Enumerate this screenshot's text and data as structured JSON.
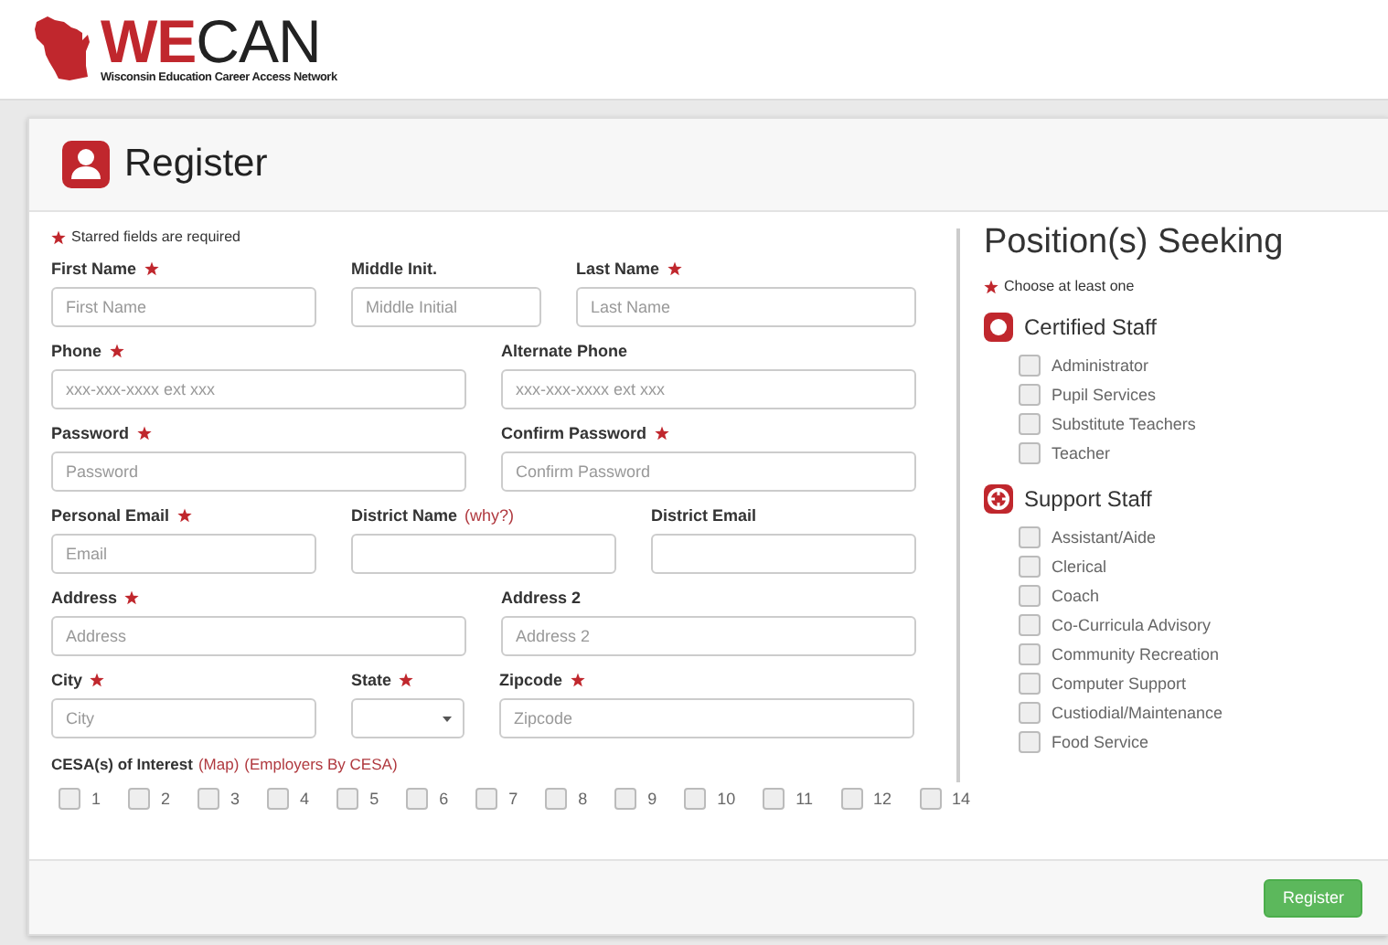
{
  "logo": {
    "wordmark_accent": "WE",
    "wordmark_rest": "CAN",
    "tagline": "Wisconsin Education Career Access Network"
  },
  "panel": {
    "title": "Register"
  },
  "form": {
    "required_note": "Starred fields are required",
    "rows": [
      {
        "fields": [
          {
            "label": "First Name",
            "required": true,
            "kind": "text",
            "placeholder": "First Name"
          },
          {
            "label": "Middle Init.",
            "required": false,
            "kind": "text",
            "placeholder": "Middle Initial"
          },
          {
            "label": "Last Name",
            "required": true,
            "kind": "text",
            "placeholder": "Last Name"
          }
        ]
      },
      {
        "fields": [
          {
            "label": "Phone",
            "required": true,
            "kind": "text",
            "placeholder": "xxx-xxx-xxxx ext xxx"
          },
          {
            "label": "Alternate Phone",
            "required": false,
            "kind": "text",
            "placeholder": "xxx-xxx-xxxx ext xxx"
          }
        ]
      },
      {
        "fields": [
          {
            "label": "Password",
            "required": true,
            "kind": "text",
            "placeholder": "Password"
          },
          {
            "label": "Confirm Password",
            "required": true,
            "kind": "text",
            "placeholder": "Confirm Password"
          }
        ]
      },
      {
        "fields": [
          {
            "label": "Personal Email",
            "required": true,
            "kind": "text",
            "placeholder": "Email"
          },
          {
            "label": "District Name",
            "link": "(why?)",
            "required": false,
            "kind": "text"
          },
          {
            "label": "District Email",
            "required": false,
            "kind": "text"
          }
        ]
      },
      {
        "fields": [
          {
            "label": "Address",
            "required": true,
            "kind": "text",
            "placeholder": "Address"
          },
          {
            "label": "Address 2",
            "required": false,
            "kind": "text",
            "placeholder": "Address 2"
          }
        ]
      },
      {
        "fields": [
          {
            "label": "City",
            "required": true,
            "kind": "text",
            "placeholder": "City"
          },
          {
            "label": "State",
            "required": true,
            "kind": "select"
          },
          {
            "label": "Zipcode",
            "required": true,
            "kind": "text",
            "placeholder": "Zipcode"
          }
        ]
      }
    ],
    "cesa": {
      "label": "CESA(s) of Interest",
      "links": [
        "(Map)",
        "(Employers By CESA)"
      ],
      "options": [
        {
          "label": "1",
          "checked": false
        },
        {
          "label": "2",
          "checked": false
        },
        {
          "label": "3",
          "checked": false
        },
        {
          "label": "4",
          "checked": false
        },
        {
          "label": "5",
          "checked": false
        },
        {
          "label": "6",
          "checked": false
        },
        {
          "label": "7",
          "checked": false
        },
        {
          "label": "8",
          "checked": false
        },
        {
          "label": "9",
          "checked": false
        },
        {
          "label": "10",
          "checked": false
        },
        {
          "label": "11",
          "checked": false
        },
        {
          "label": "12",
          "checked": false
        },
        {
          "label": "14",
          "checked": false
        }
      ]
    }
  },
  "positions": {
    "title": "Position(s) Seeking",
    "note": "Choose at least one",
    "groups": [
      {
        "title": "Certified Staff",
        "kind": "certified",
        "items": [
          {
            "label": "Administrator",
            "checked": false
          },
          {
            "label": "Pupil Services",
            "checked": false
          },
          {
            "label": "Substitute Teachers",
            "checked": false
          },
          {
            "label": "Teacher",
            "checked": false
          }
        ]
      },
      {
        "title": "Support Staff",
        "kind": "support",
        "items": [
          {
            "label": "Assistant/Aide",
            "checked": false
          },
          {
            "label": "Clerical",
            "checked": false
          },
          {
            "label": "Coach",
            "checked": false
          },
          {
            "label": "Co-Curricula Advisory",
            "checked": false
          },
          {
            "label": "Community Recreation",
            "checked": false
          },
          {
            "label": "Computer Support",
            "checked": false
          },
          {
            "label": "Custiodial/Maintenance",
            "checked": false
          },
          {
            "label": "Food Service",
            "checked": false
          }
        ]
      }
    ]
  },
  "footer": {
    "button": "Register"
  }
}
